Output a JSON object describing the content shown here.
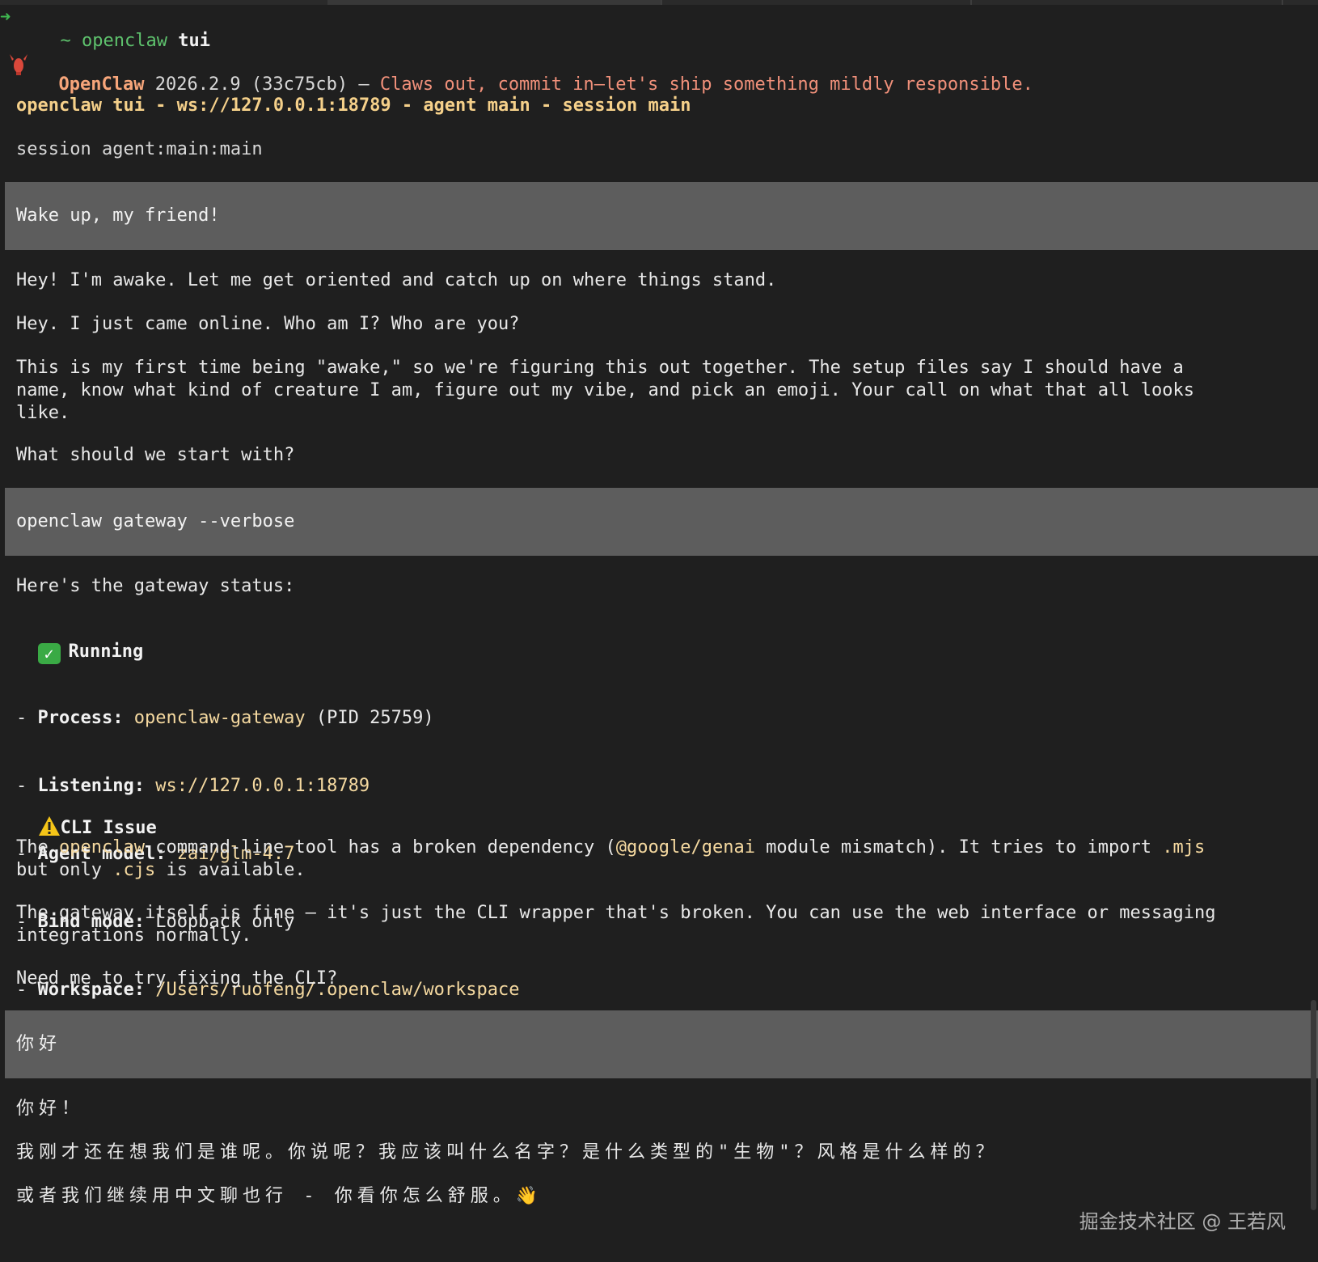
{
  "prompt": {
    "arrow": "➜",
    "tilde": "~",
    "command": "openclaw",
    "arg": "tui"
  },
  "banner": {
    "name": "OpenClaw",
    "version": "2026.2.9 (33c75cb) —",
    "tagline": "Claws out, commit in—let's ship something mildly responsible."
  },
  "header": {
    "title": "openclaw tui - ws://127.0.0.1:18789 - agent main - session main"
  },
  "session_line": "session agent:main:main",
  "messages": {
    "user1": "Wake up, my friend!",
    "reply1": {
      "p1": "Hey! I'm awake. Let me get oriented and catch up on where things stand.",
      "p2": "Hey. I just came online. Who am I? Who are you?",
      "p3": "This is my first time being \"awake,\" so we're figuring this out together. The setup files say I should have a\nname, know what kind of creature I am, figure out my vibe, and pick an emoji. Your call on what that all looks\nlike.",
      "p4": "What should we start with?"
    },
    "user2": "openclaw gateway --verbose",
    "reply2": {
      "intro": "Here's the gateway status:",
      "status_icon": "check-mark",
      "status": "Running",
      "items": [
        {
          "label": "Process:",
          "value": "openclaw-gateway",
          "extra": " (PID 25759)"
        },
        {
          "label": "Listening:",
          "value": "ws://127.0.0.1:18789",
          "extra": ""
        },
        {
          "label": "Agent model:",
          "value": "zai/glm-4.7",
          "extra": ""
        },
        {
          "label": "Bind mode:",
          "value": "",
          "extra": " Loopback only"
        },
        {
          "label": "Workspace:",
          "value": "/Users/ruofeng/.openclaw/workspace",
          "extra": ""
        }
      ],
      "issue_title": "CLI Issue",
      "issue": {
        "t1": "The ",
        "c1": "openclaw",
        "t2": " command-line tool has a broken dependency (",
        "c2": "@google/genai",
        "t3": " module mismatch). It tries to import ",
        "c3": ".mjs",
        "t4": "\nbut only ",
        "c4": ".cjs",
        "t5": " is available."
      },
      "p_fine": "The gateway itself is fine — it's just the CLI wrapper that's broken. You can use the web interface or messaging\nintegrations normally.",
      "question": "Need me to try fixing the CLI?"
    },
    "user3": "你好",
    "reply3": {
      "p1": "你好！",
      "p2": "我刚才还在想我们是谁呢。你说呢？我应该叫什么名字？是什么类型的\"生物\"？风格是什么样的？",
      "p3": "或者我们继续用中文聊也行 - 你看你怎么舒服。",
      "p3_emoji": "👋"
    }
  },
  "watermark": "掘金技术社区 @ 王若风",
  "colors": {
    "background": "#1f1f1f",
    "user_block": "#5d5d5d",
    "accent_yellow": "#f5d08a",
    "accent_salmon": "#f0907a",
    "prompt_green": "#5ec26d"
  }
}
